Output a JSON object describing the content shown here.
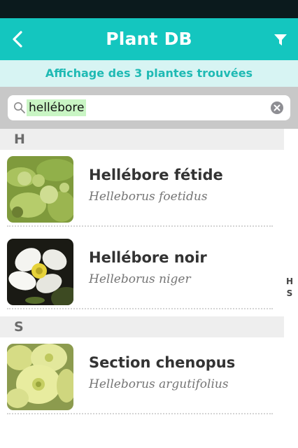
{
  "nav": {
    "title": "Plant DB",
    "back_icon": "chevron-left-icon",
    "filter_icon": "filter-icon",
    "accent": "#14c6bf"
  },
  "results_banner": "Affichage des 3 plantes trouvées",
  "search": {
    "value": "hellébore",
    "search_icon": "search-icon",
    "clear_icon": "clear-icon"
  },
  "sections": [
    {
      "letter": "H",
      "plants": [
        {
          "name": "Hellébore fétide",
          "latin": "Helleborus foetidus",
          "thumb": "green-hellebore-flowers"
        },
        {
          "name": "Hellébore noir",
          "latin": "Helleborus niger",
          "thumb": "white-hellebore-flower"
        }
      ]
    },
    {
      "letter": "S",
      "plants": [
        {
          "name": "Section chenopus",
          "latin": "Helleborus argutifolius",
          "thumb": "pale-yellow-hellebore-flowers"
        }
      ]
    }
  ],
  "index": [
    "H",
    "S"
  ]
}
